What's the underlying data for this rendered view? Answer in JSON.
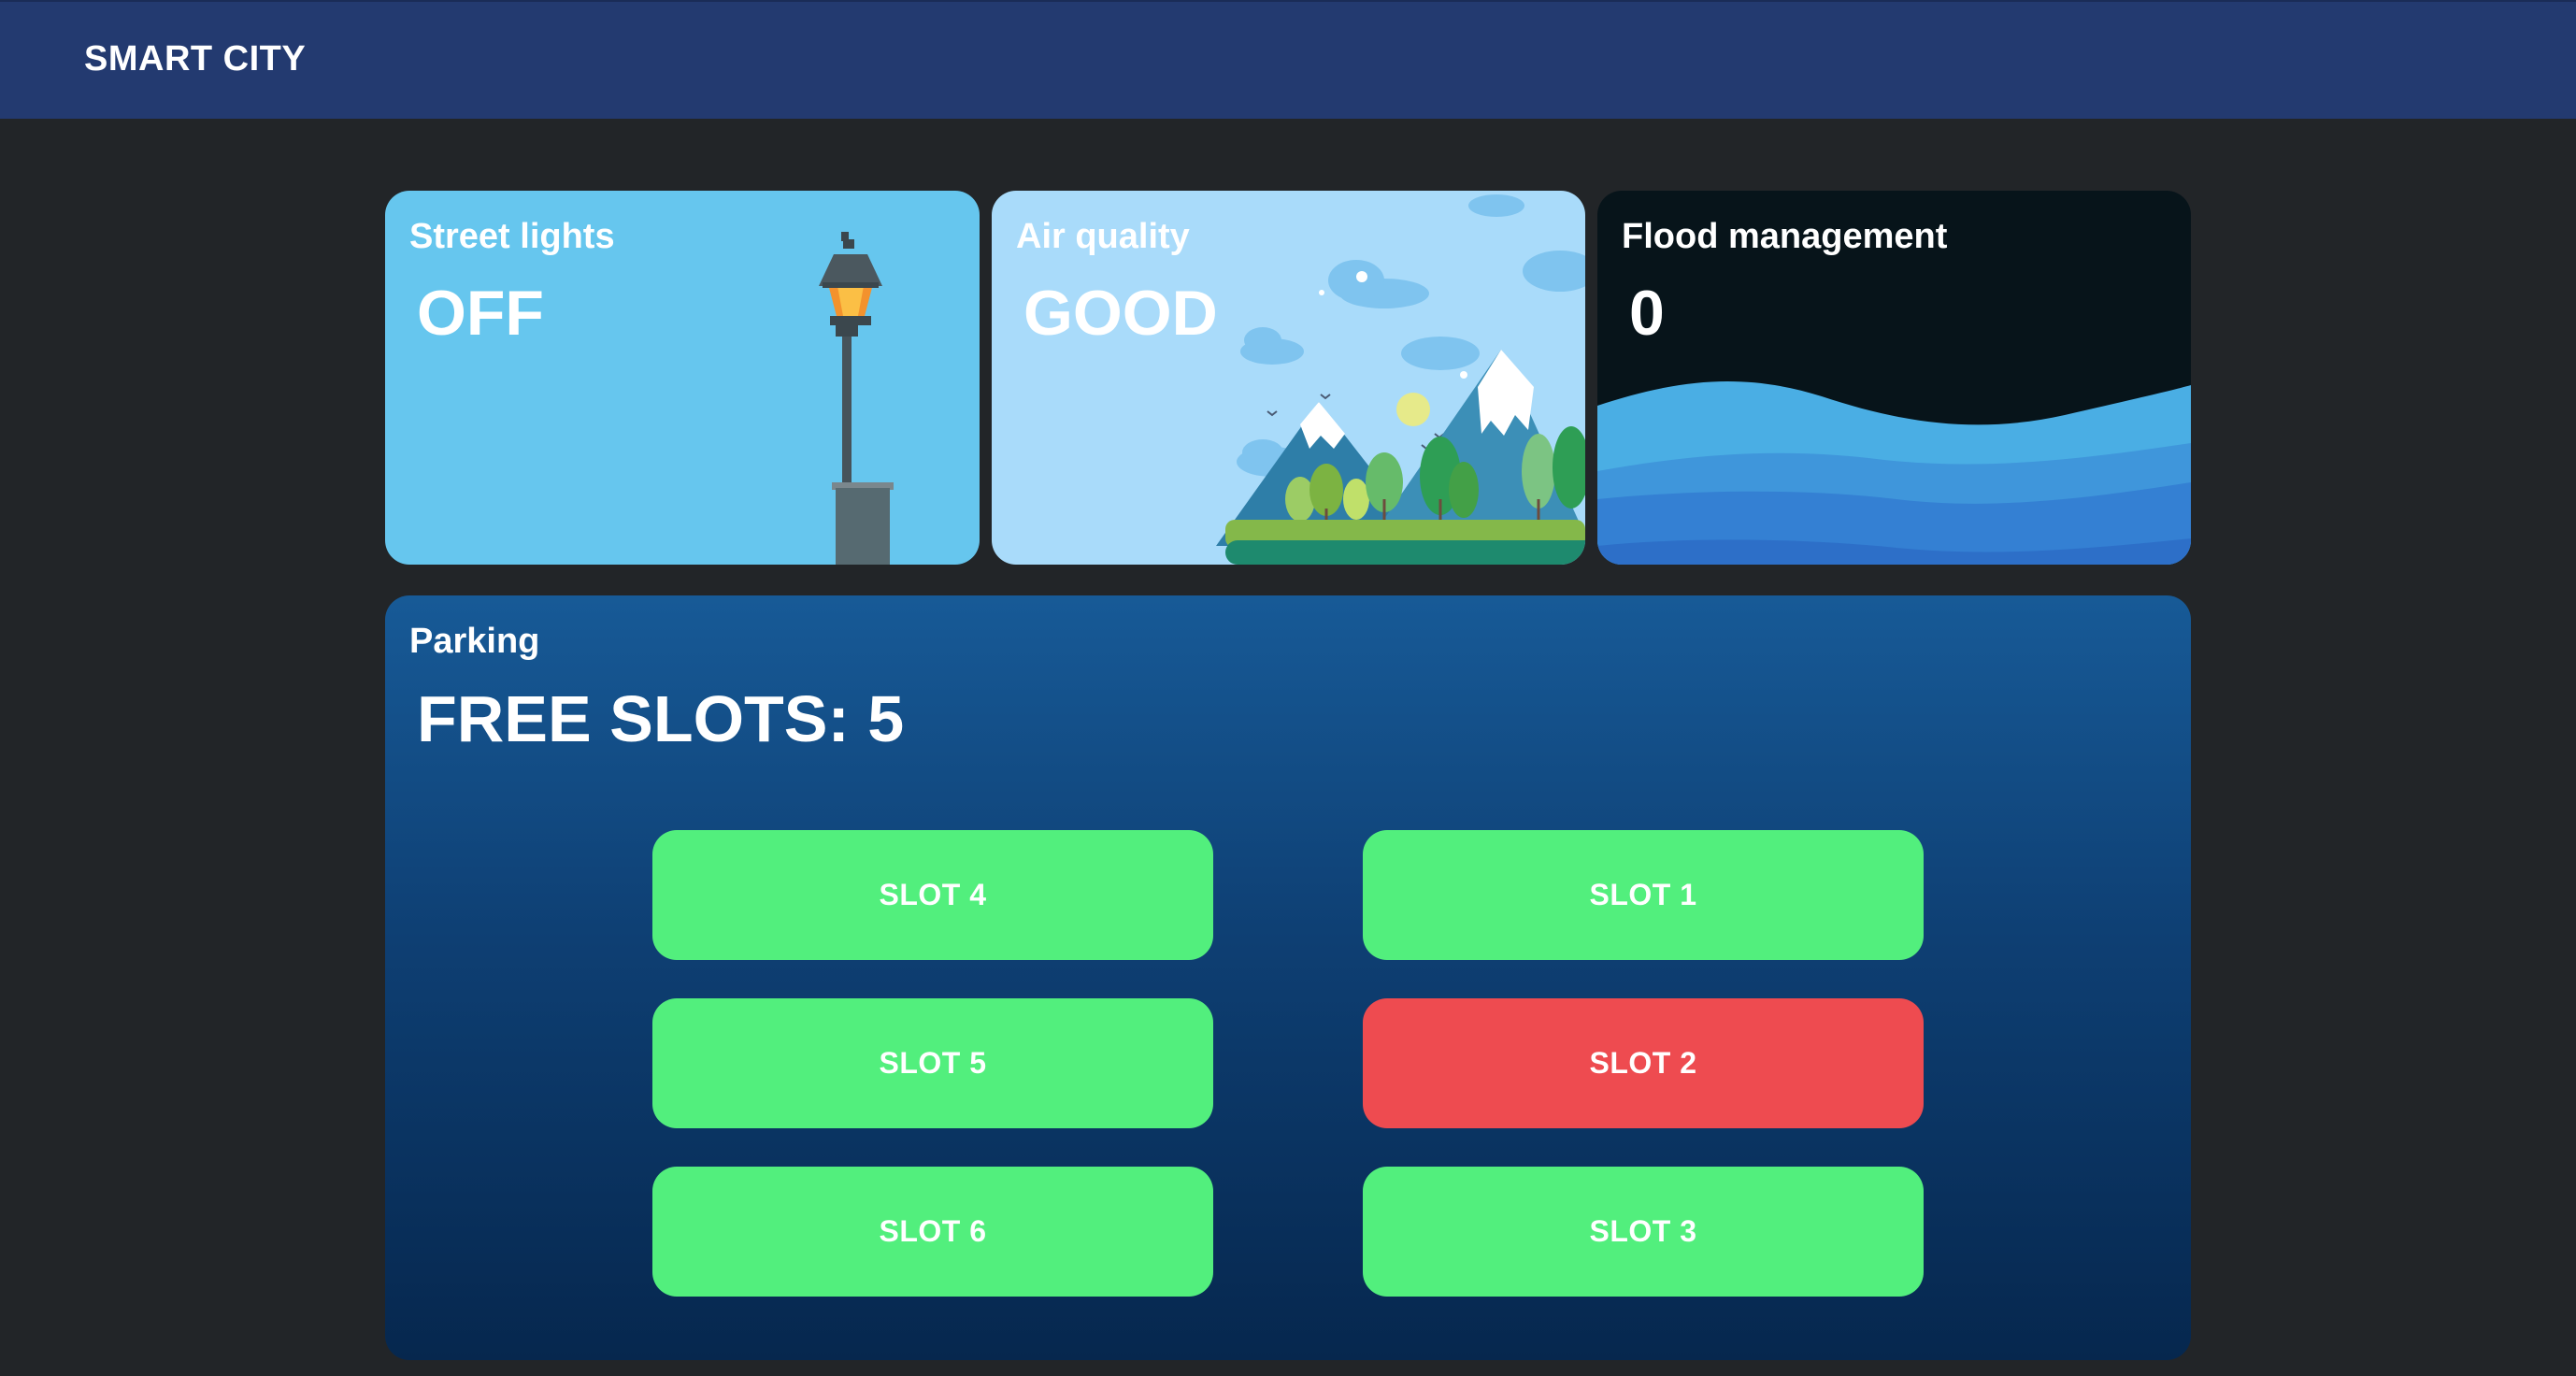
{
  "app": {
    "title": "SMART CITY"
  },
  "cards": {
    "street_lights": {
      "title": "Street lights",
      "value": "OFF",
      "icon": "street-lamp"
    },
    "air_quality": {
      "title": "Air quality",
      "value": "GOOD",
      "icon": "mountain-landscape"
    },
    "flood": {
      "title": "Flood management",
      "value": "0",
      "icon": "water-waves"
    }
  },
  "parking": {
    "title": "Parking",
    "free_label": "FREE SLOTS: 5",
    "slots": [
      {
        "label": "SLOT 4",
        "status": "free"
      },
      {
        "label": "SLOT 1",
        "status": "free"
      },
      {
        "label": "SLOT 5",
        "status": "free"
      },
      {
        "label": "SLOT 2",
        "status": "occupied"
      },
      {
        "label": "SLOT 6",
        "status": "free"
      },
      {
        "label": "SLOT 3",
        "status": "free"
      }
    ]
  },
  "colors": {
    "free": "#52ef7d",
    "occupied": "#ee4b50",
    "header": "#233a70",
    "background": "#222528"
  }
}
